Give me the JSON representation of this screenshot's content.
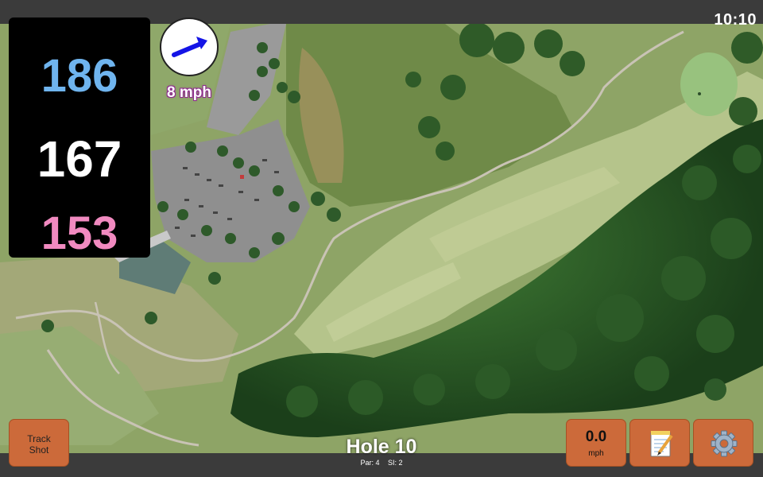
{
  "status_bar": {
    "time": "10:10"
  },
  "distances": {
    "back": "186",
    "center": "167",
    "front": "153"
  },
  "colors": {
    "back": "#6fb4ee",
    "center": "#ffffff",
    "front": "#f18ac0",
    "button": "#cc6a3a",
    "wind_arrow": "#1414e6"
  },
  "wind": {
    "speed": "8 mph",
    "icon": "wind-direction-arrow"
  },
  "buttons": {
    "track_shot": {
      "line1": "Track",
      "line2": "Shot"
    },
    "speed": {
      "value": "0.0",
      "unit": "mph"
    },
    "notes": {
      "icon": "notepad-icon"
    },
    "settings": {
      "icon": "gear-icon"
    }
  },
  "hole": {
    "title": "Hole 10",
    "par": "Par: 4",
    "si": "SI: 2"
  }
}
